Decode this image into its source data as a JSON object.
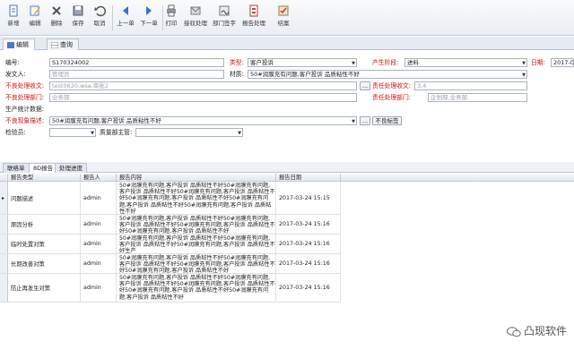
{
  "toolbar": {
    "buttons": [
      {
        "label": "新增",
        "icon": "new-doc-icon"
      },
      {
        "label": "编辑",
        "icon": "edit-icon"
      },
      {
        "label": "删除",
        "icon": "delete-icon"
      },
      {
        "label": "保存",
        "icon": "save-icon"
      },
      {
        "label": "取消",
        "icon": "undo-icon"
      },
      {
        "label": "上一单",
        "icon": "arrow-left-icon"
      },
      {
        "label": "下一单",
        "icon": "arrow-right-icon"
      },
      {
        "label": "打印",
        "icon": "print-icon"
      },
      {
        "label": "接収处理",
        "icon": "receive-icon"
      },
      {
        "label": "部门签字",
        "icon": "sign-icon"
      },
      {
        "label": "报告处理",
        "icon": "report-icon"
      },
      {
        "label": "结案",
        "icon": "close-case-icon"
      }
    ]
  },
  "tabs": {
    "edit": "编辑",
    "browse": "查询"
  },
  "form": {
    "code_label": "编号:",
    "code_value": "S170324002",
    "type_label": "类型:",
    "type_value": "客户投诉",
    "source_label": "产生阶段:",
    "source_value": "进料",
    "date_label": "日期:",
    "date_value": "2017-0",
    "sender_label": "发文人:",
    "sender_value": "管理员",
    "material_label": "材质:",
    "material_value": "50#润膜充有问题,客户投诉 品质粘性不好",
    "defect_recv_label": "不良处理收文:",
    "defect_recv_value": "test0620,wsa,审批2",
    "resp_recv_label": "责任处理收文:",
    "resp_recv_value": "3,4",
    "defect_dept_label": "不良处理部门:",
    "defect_dept_value": "业务部",
    "resp_dept_label": "责任处理部门:",
    "resp_dept_value": "企划部,业务部",
    "prod_stat_label": "生产统计数据:",
    "defect_desc_label": "不良现象描述:",
    "defect_desc_value": "50#润膜充有问题,客户投诉 品质粘性不好",
    "defect_tag_button": "不良标签",
    "ellipsis_button": "...",
    "inspector_label": "检验员:",
    "qa_label": "质量部主管:"
  },
  "lower_tabs": {
    "t1": "联络单",
    "t2": "8D报告",
    "t3": "处理进度"
  },
  "grid": {
    "headers": {
      "type": "报告类型",
      "person": "报告人",
      "content": "报告内容",
      "date": "报告日期"
    },
    "rows": [
      {
        "type": "问题描述",
        "person": "admin",
        "content": "50#润膜充有问题,客户投诉 品质粘性不好50#润膜充有问题,客户投诉 品质粘性不好50#润膜充有问题,客户投诉 品质粘性不好50#润膜充有问题,客户投诉 品质粘性不好50#润膜充有问题,客户投诉 品质粘性不好50#润膜充有问题,客户投诉 品质粘性不好",
        "date": "2017-03-24 15:15"
      },
      {
        "type": "原因分析",
        "person": "admin",
        "content": "50#润膜充有问题,客户投诉 品质粘性不好50#润膜充有问题,客户投诉 品质粘性不好50#润膜充有问题,客户投诉 品质粘性不好50#润膜充有问题,客户投诉 品质粘性不好",
        "date": "2017-03-24 15:16"
      },
      {
        "type": "临时处置对策",
        "person": "admin",
        "content": "50#润膜充有问题,客户投诉 品质粘性不好50#润膜充有问题,客户投诉 品质粘性不好50#润膜充有问题,客户投诉 品质粘性不好生产",
        "date": "2017-03-24 15:16"
      },
      {
        "type": "长期改善对策",
        "person": "admin",
        "content": "50#润膜充有问题,客户投诉 品质粘性不好50#润膜充有问题,客户投诉 品质粘性不好50#润膜充有问题,客户投诉 品质粘性不好50#润膜充有问题,客户投诉 品质粘性不好",
        "date": "2017-03-24 15:16"
      },
      {
        "type": "防止再发生对策",
        "person": "admin",
        "content": "50#润膜充有问题,客户投诉 品质粘性不好50#润膜充有问题,客户投诉 品质粘性不好50#润膜充有问题,客户投诉 品质粘性不好50#润膜充有问题,客户投诉 品质粘性不好50#润膜充有问题,客户投诉 品质粘性不好",
        "date": "2017-03-24 15:16"
      }
    ]
  },
  "watermark": "凸现软件",
  "colors": {
    "required_label": "#d01010",
    "toolbar_bg": "#e9eef5"
  }
}
